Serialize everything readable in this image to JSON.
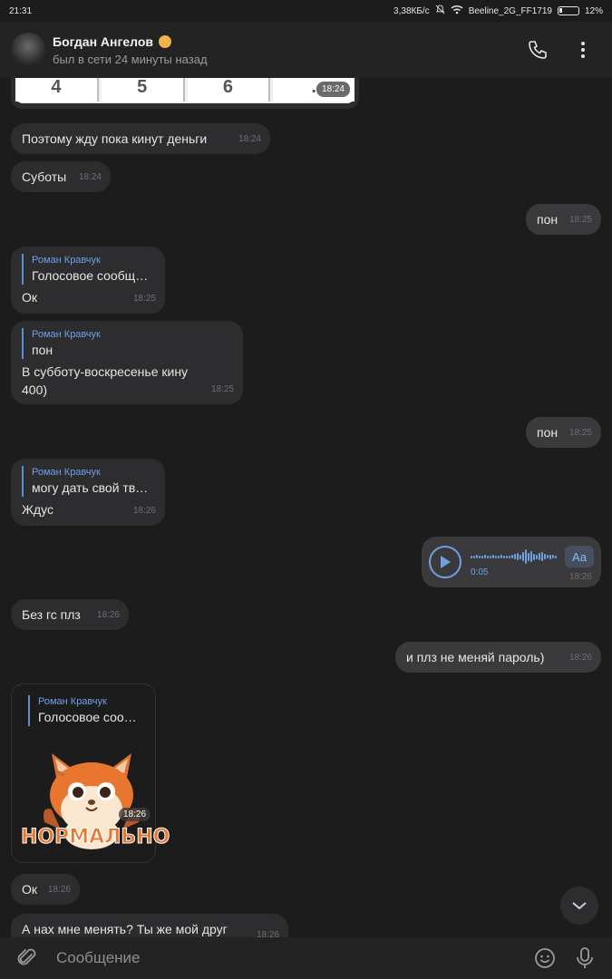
{
  "status_bar": {
    "time": "21:31",
    "speed": "3,38КБ/с",
    "network": "Beeline_2G_FF1719",
    "battery": "12%"
  },
  "header": {
    "name": "Богдан Ангелов",
    "status": "был в сети 24 минуты назад",
    "call_icon": "phone-icon",
    "menu_icon": "more-vertical-icon"
  },
  "keypad_image": {
    "keys": [
      "4",
      "5",
      "6",
      "."
    ],
    "time": "18:24"
  },
  "messages": [
    {
      "id": "m1",
      "text": "Поэтому жду пока кинут деньги",
      "time": "18:24"
    },
    {
      "id": "m2",
      "text": "Суботы",
      "time": "18:24"
    },
    {
      "id": "m3",
      "text": "пон",
      "time": "18:25"
    },
    {
      "id": "m4",
      "reply_name": "Роман Кравчук",
      "reply_text": "Голосовое сообщ…",
      "text": "Ок",
      "time": "18:25"
    },
    {
      "id": "m5",
      "reply_name": "Роман Кравчук",
      "reply_text": "пон",
      "text": "В субботу-воскресенье кину 400)",
      "time": "18:25"
    },
    {
      "id": "m6",
      "text": "пон",
      "time": "18:25"
    },
    {
      "id": "m7",
      "reply_name": "Роман Кравчук",
      "reply_text": "могу дать свой тв…",
      "text": "Ждус",
      "time": "18:26"
    },
    {
      "id": "m8",
      "voice_duration": "0:05",
      "transcribe_label": "Aa",
      "time": "18:26"
    },
    {
      "id": "m9",
      "text": "Без гс плз",
      "time": "18:26"
    },
    {
      "id": "m10",
      "text": "и плз не меняй пароль)",
      "time": "18:26"
    },
    {
      "id": "m11",
      "reply_name": "Роман Кравчук",
      "reply_text": "Голосовое соо…",
      "sticker_text": "НОРМАЛЬНО",
      "time": "18:26"
    },
    {
      "id": "m12",
      "text": "Ок",
      "time": "18:26"
    },
    {
      "id": "m13",
      "text": "А нах мне менять? Ты же мой друг",
      "time": "18:26"
    }
  ],
  "input": {
    "placeholder": "Сообщение"
  },
  "colors": {
    "background": "#1c1c1d",
    "bubble_in": "#2d2d2f",
    "bubble_out": "#3a3a3c",
    "accent": "#6ea0e4"
  }
}
